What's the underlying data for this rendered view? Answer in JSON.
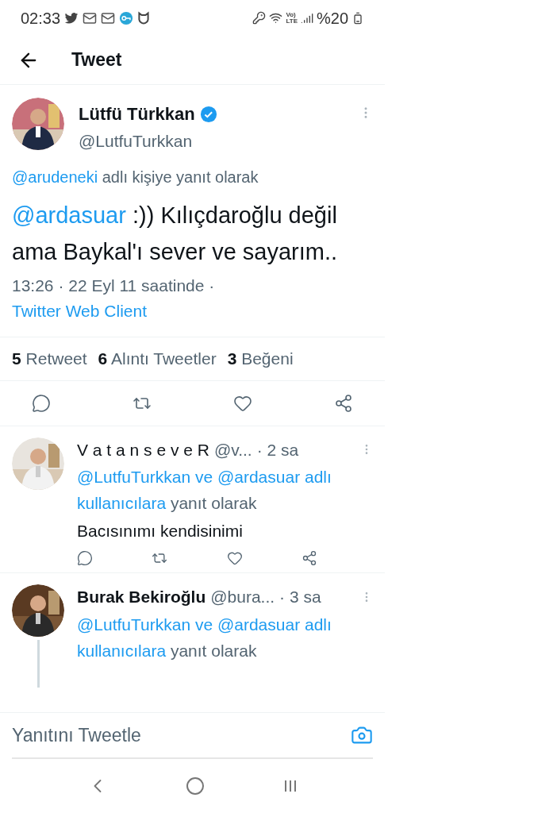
{
  "status_bar": {
    "time": "02:33",
    "network": [
      "Vo)",
      "LTE"
    ],
    "battery": "%20"
  },
  "header": {
    "title": "Tweet"
  },
  "main_tweet": {
    "name": "Lütfü Türkkan",
    "verified": true,
    "handle": "@LutfuTurkkan",
    "reply_to_link": "@arudeneki",
    "reply_to_text": "adlı kişiye yanıt olarak",
    "body_mention": "@ardasuar",
    "body_text": ":)) Kılıçdaroğlu değil ama Baykal'ı sever ve sayarım..",
    "meta": "13:26 · 22 Eyl 11 saatinde ·",
    "source": "Twitter Web Client",
    "stats": [
      {
        "count": "5",
        "label": "Retweet"
      },
      {
        "count": "6",
        "label": "Alıntı Tweetler"
      },
      {
        "count": "3",
        "label": "Beğeni"
      }
    ]
  },
  "replies": [
    {
      "name": "V a t a n s e v e R",
      "bold": false,
      "handle": "@v...",
      "time": "· 2 sa",
      "reply_to_link": "@LutfuTurkkan ve @ardasuar adlı kullanıcılara",
      "reply_to_text": "yanıt olarak",
      "body": "Bacısınımı kendisinimi",
      "thread": false,
      "actions": true
    },
    {
      "name": "Burak Bekiroğlu",
      "bold": true,
      "handle": "@bura...",
      "time": "· 3 sa",
      "reply_to_link": "@LutfuTurkkan ve @ardasuar adlı kullanıcılara",
      "reply_to_text": "yanıt olarak",
      "thread": true,
      "actions": false
    }
  ],
  "composer": {
    "placeholder": "Yanıtını Tweetle"
  }
}
